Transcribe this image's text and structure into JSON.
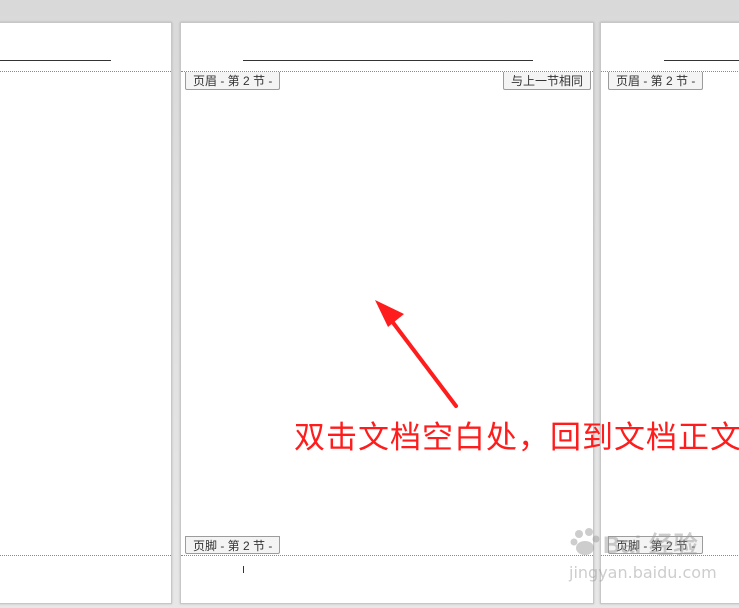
{
  "page_left": {},
  "page_center": {
    "header_tag": "页眉 - 第 2 节 -",
    "same_as_previous": "与上一节相同",
    "footer_tag": "页脚 - 第 2 节 -"
  },
  "page_right": {
    "header_tag": "页眉 - 第 2 节 -",
    "footer_tag": "页脚 - 第 2 节 -"
  },
  "annotation": {
    "text": "双击文档空白处，回到文档正文",
    "color": "#ff1c1c"
  },
  "watermark": {
    "brand": "Bai 经验",
    "site": "jingyan.baidu.com"
  }
}
